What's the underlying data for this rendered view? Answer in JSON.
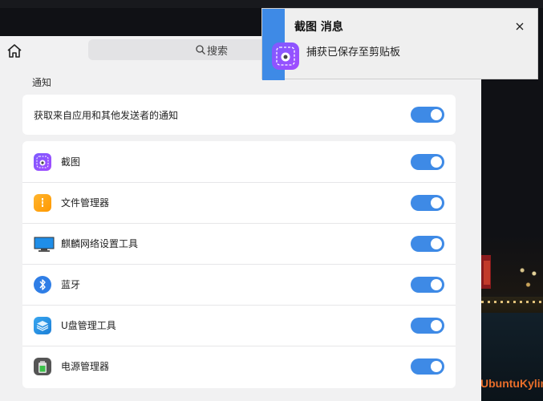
{
  "search": {
    "label": "搜索"
  },
  "notifications": {
    "section_title": "通知",
    "main_toggle": {
      "label": "获取来自应用和其他发送者的通知",
      "enabled": true
    },
    "apps": [
      {
        "label": "截图",
        "icon": "screenshot-app-icon",
        "enabled": true
      },
      {
        "label": "文件管理器",
        "icon": "file-manager-icon",
        "enabled": true
      },
      {
        "label": "麒麟网络设置工具",
        "icon": "network-settings-icon",
        "enabled": true
      },
      {
        "label": "蓝牙",
        "icon": "bluetooth-icon",
        "enabled": true
      },
      {
        "label": "U盘管理工具",
        "icon": "usb-manager-icon",
        "enabled": true
      },
      {
        "label": "电源管理器",
        "icon": "power-manager-icon",
        "enabled": true
      }
    ]
  },
  "popup": {
    "title": "截图 消息",
    "body": "捕获已保存至剪贴板"
  },
  "brand": {
    "text": "UbuntuKylin"
  },
  "colors": {
    "accent": "#3e8ae6",
    "brand": "#e96e2a"
  }
}
